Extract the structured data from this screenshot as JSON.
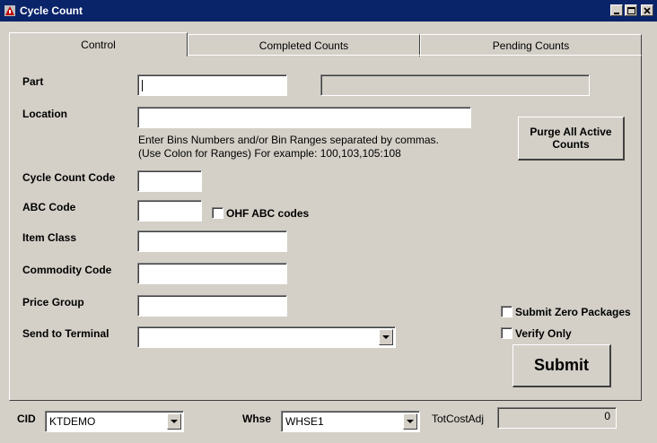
{
  "window": {
    "title": "Cycle Count"
  },
  "tabs": [
    {
      "label": "Control",
      "active": true
    },
    {
      "label": "Completed Counts",
      "active": false
    },
    {
      "label": "Pending Counts",
      "active": false
    }
  ],
  "form": {
    "part_label": "Part",
    "part_value": "",
    "part_description": "",
    "location_label": "Location",
    "location_value": "",
    "location_hint_1": "Enter Bins Numbers and/or Bin Ranges separated by commas.",
    "location_hint_2": "(Use Colon for Ranges)  For example: 100,103,105:108",
    "cycle_count_code_label": "Cycle Count Code",
    "cycle_count_code_value": "",
    "abc_code_label": "ABC Code",
    "abc_code_value": "",
    "ohf_abc_codes_label": "OHF ABC codes",
    "ohf_abc_codes_checked": false,
    "item_class_label": "Item Class",
    "item_class_value": "",
    "commodity_code_label": "Commodity Code",
    "commodity_code_value": "",
    "price_group_label": "Price Group",
    "price_group_value": "",
    "send_to_terminal_label": "Send to Terminal",
    "send_to_terminal_value": ""
  },
  "actions": {
    "purge_label": "Purge All Active Counts",
    "submit_zero_packages_label": "Submit Zero Packages",
    "submit_zero_packages_checked": false,
    "verify_only_label": "Verify Only",
    "verify_only_checked": false,
    "submit_label": "Submit"
  },
  "footer": {
    "cid_label": "CID",
    "cid_value": "KTDEMO",
    "whse_label": "Whse",
    "whse_value": "WHSE1",
    "tot_cost_adj_label": "TotCostAdj",
    "tot_cost_adj_value": "0"
  },
  "icons": {
    "app": "app-icon",
    "minimize": "minimize-icon",
    "maximize": "maximize-icon",
    "close": "close-icon",
    "dropdown": "chevron-down-icon"
  },
  "colors": {
    "titlebar": "#0a246a",
    "surface": "#d4d0c8"
  }
}
